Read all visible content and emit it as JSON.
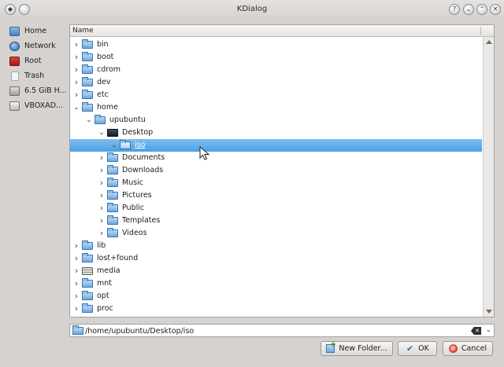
{
  "window": {
    "title": "KDialog"
  },
  "places": [
    {
      "label": "Home",
      "icon": "home-folder-icon"
    },
    {
      "label": "Network",
      "icon": "network-icon"
    },
    {
      "label": "Root",
      "icon": "root-folder-icon"
    },
    {
      "label": "Trash",
      "icon": "trash-icon"
    },
    {
      "label": "6.5 GiB H...",
      "icon": "hard-disk-icon"
    },
    {
      "label": "VBOXAD...",
      "icon": "optical-disc-icon"
    }
  ],
  "tree": {
    "column_header": "Name",
    "rows": [
      {
        "label": "bin",
        "expanded": false
      },
      {
        "label": "boot",
        "expanded": false
      },
      {
        "label": "cdrom",
        "expanded": false
      },
      {
        "label": "dev",
        "expanded": false
      },
      {
        "label": "etc",
        "expanded": false
      },
      {
        "label": "home",
        "expanded": true
      },
      {
        "label": "upubuntu",
        "expanded": true
      },
      {
        "label": "Desktop",
        "expanded": true
      },
      {
        "label": "iso",
        "expanded": true,
        "selected": true
      },
      {
        "label": "Documents",
        "expanded": false
      },
      {
        "label": "Downloads",
        "expanded": false
      },
      {
        "label": "Music",
        "expanded": false
      },
      {
        "label": "Pictures",
        "expanded": false
      },
      {
        "label": "Public",
        "expanded": false
      },
      {
        "label": "Templates",
        "expanded": false
      },
      {
        "label": "Videos",
        "expanded": false
      },
      {
        "label": "lib",
        "expanded": false
      },
      {
        "label": "lost+found",
        "expanded": false
      },
      {
        "label": "media",
        "expanded": false
      },
      {
        "label": "mnt",
        "expanded": false
      },
      {
        "label": "opt",
        "expanded": false
      },
      {
        "label": "proc",
        "expanded": false
      }
    ]
  },
  "location": {
    "value": "/home/upubuntu/Desktop/iso"
  },
  "buttons": {
    "new_folder": "New Folder...",
    "ok": "OK",
    "cancel": "Cancel"
  },
  "colors": {
    "selection": "#4aa1e5",
    "folder": "#6ea7dc"
  }
}
